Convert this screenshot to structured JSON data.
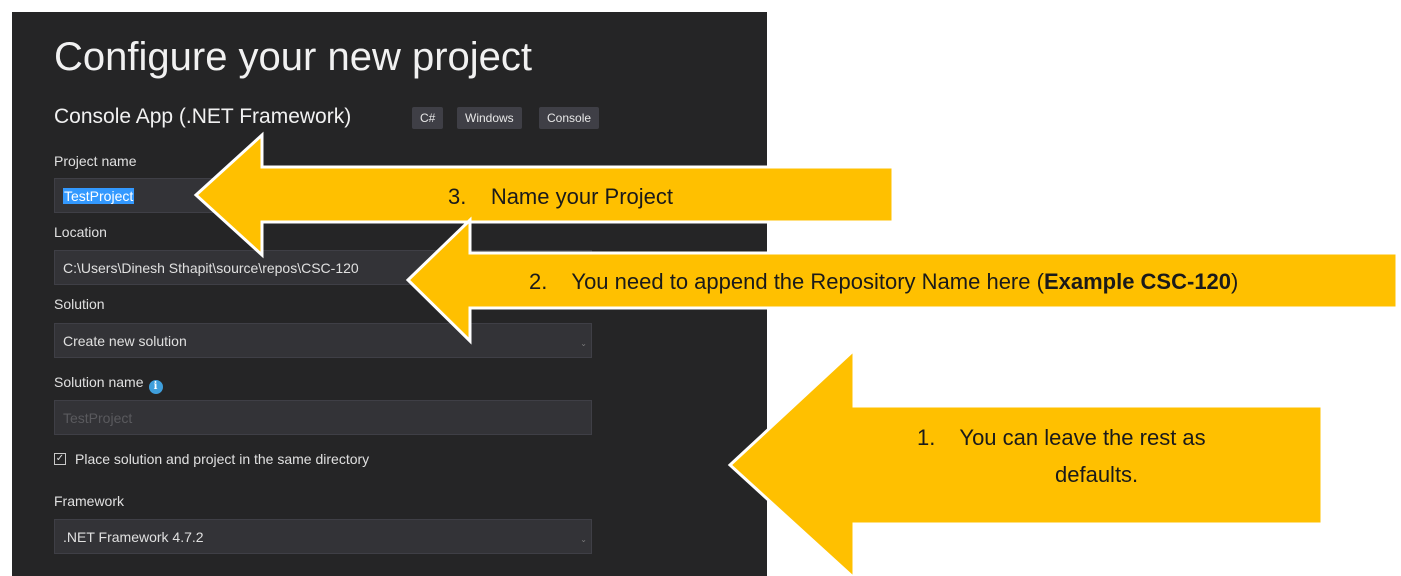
{
  "dialog": {
    "title": "Configure your new project",
    "template_name": "Console App (.NET Framework)",
    "tags": [
      "C#",
      "Windows",
      "Console"
    ],
    "project_name": {
      "label": "Project name",
      "value": "TestProject"
    },
    "location": {
      "label": "Location",
      "value": "C:\\Users\\Dinesh Sthapit\\source\\repos\\CSC-120"
    },
    "solution": {
      "label": "Solution",
      "value": "Create new solution"
    },
    "solution_name": {
      "label": "Solution name",
      "placeholder": "TestProject",
      "info_icon": "info-icon"
    },
    "same_directory": {
      "label": "Place solution and project in the same directory",
      "checked": true
    },
    "framework": {
      "label": "Framework",
      "value": ".NET Framework 4.7.2"
    }
  },
  "annotations": {
    "step3": {
      "number": "3.",
      "text": "Name your Project"
    },
    "step2": {
      "number": "2.",
      "text": "You need to append the Repository Name here (",
      "bold": "Example CSC-120",
      "tail": ")"
    },
    "step1": {
      "number": "1.",
      "line1": "You can leave the rest as",
      "line2": "defaults."
    },
    "arrow_color": "#ffc000"
  }
}
